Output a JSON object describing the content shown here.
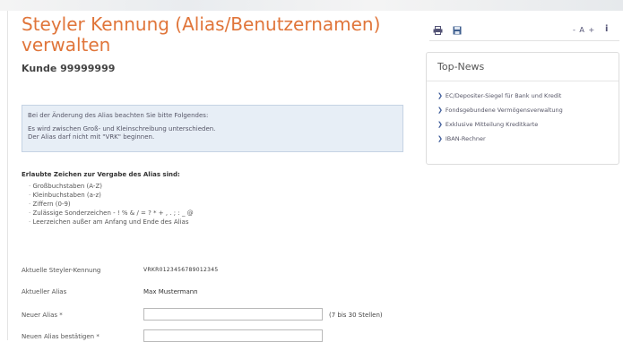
{
  "main": {
    "title": "Steyler Kennung (Alias/Benutzernamen) verwalten",
    "customer": "Kunde 99999999",
    "info": {
      "line1": "Bei der Änderung des Alias beachten Sie bitte Folgendes:",
      "line2": "Es wird zwischen Groß- und Kleinschreibung unterschieden.",
      "line3": "Der Alias darf nicht mit \"VRK\" beginnen."
    },
    "rules": {
      "heading": "Erlaubte Zeichen zur Vergabe des Alias sind:",
      "items": [
        "Großbuchstaben (A-Z)",
        "Kleinbuchstaben (a-z)",
        "Ziffern (0-9)",
        "Zulässige Sonderzeichen - ! % & / = ? * + , . ; : _ @",
        "Leerzeichen außer am Anfang und Ende des Alias"
      ]
    },
    "form": {
      "current_id_label": "Aktuelle Steyler-Kennung",
      "current_id_value": "VRKR0123456789012345",
      "current_alias_label": "Aktueller Alias",
      "current_alias_value": "Max Mustermann",
      "new_alias_label": "Neuer Alias *",
      "new_alias_hint": "(7 bis 30 Stellen)",
      "confirm_alias_label": "Neuen Alias bestätigen *"
    }
  },
  "sidebar": {
    "toolbar": {
      "print_icon": "print-icon",
      "save_icon": "save-icon",
      "font_size": "- A +",
      "info_icon": "info-icon",
      "info_symbol": "i"
    },
    "news": {
      "title": "Top-News",
      "items": [
        "EC/Depositer-Siegel für Bank und Kredit",
        "Fondsgebundene Vermögensverwaltung",
        "Exklusive Mitteilung Kreditkarte",
        "IBAN-Rechner"
      ]
    }
  },
  "colors": {
    "title": "#e0753a",
    "info_bg": "#e7eef6",
    "link_arrow": "#3b5998"
  }
}
